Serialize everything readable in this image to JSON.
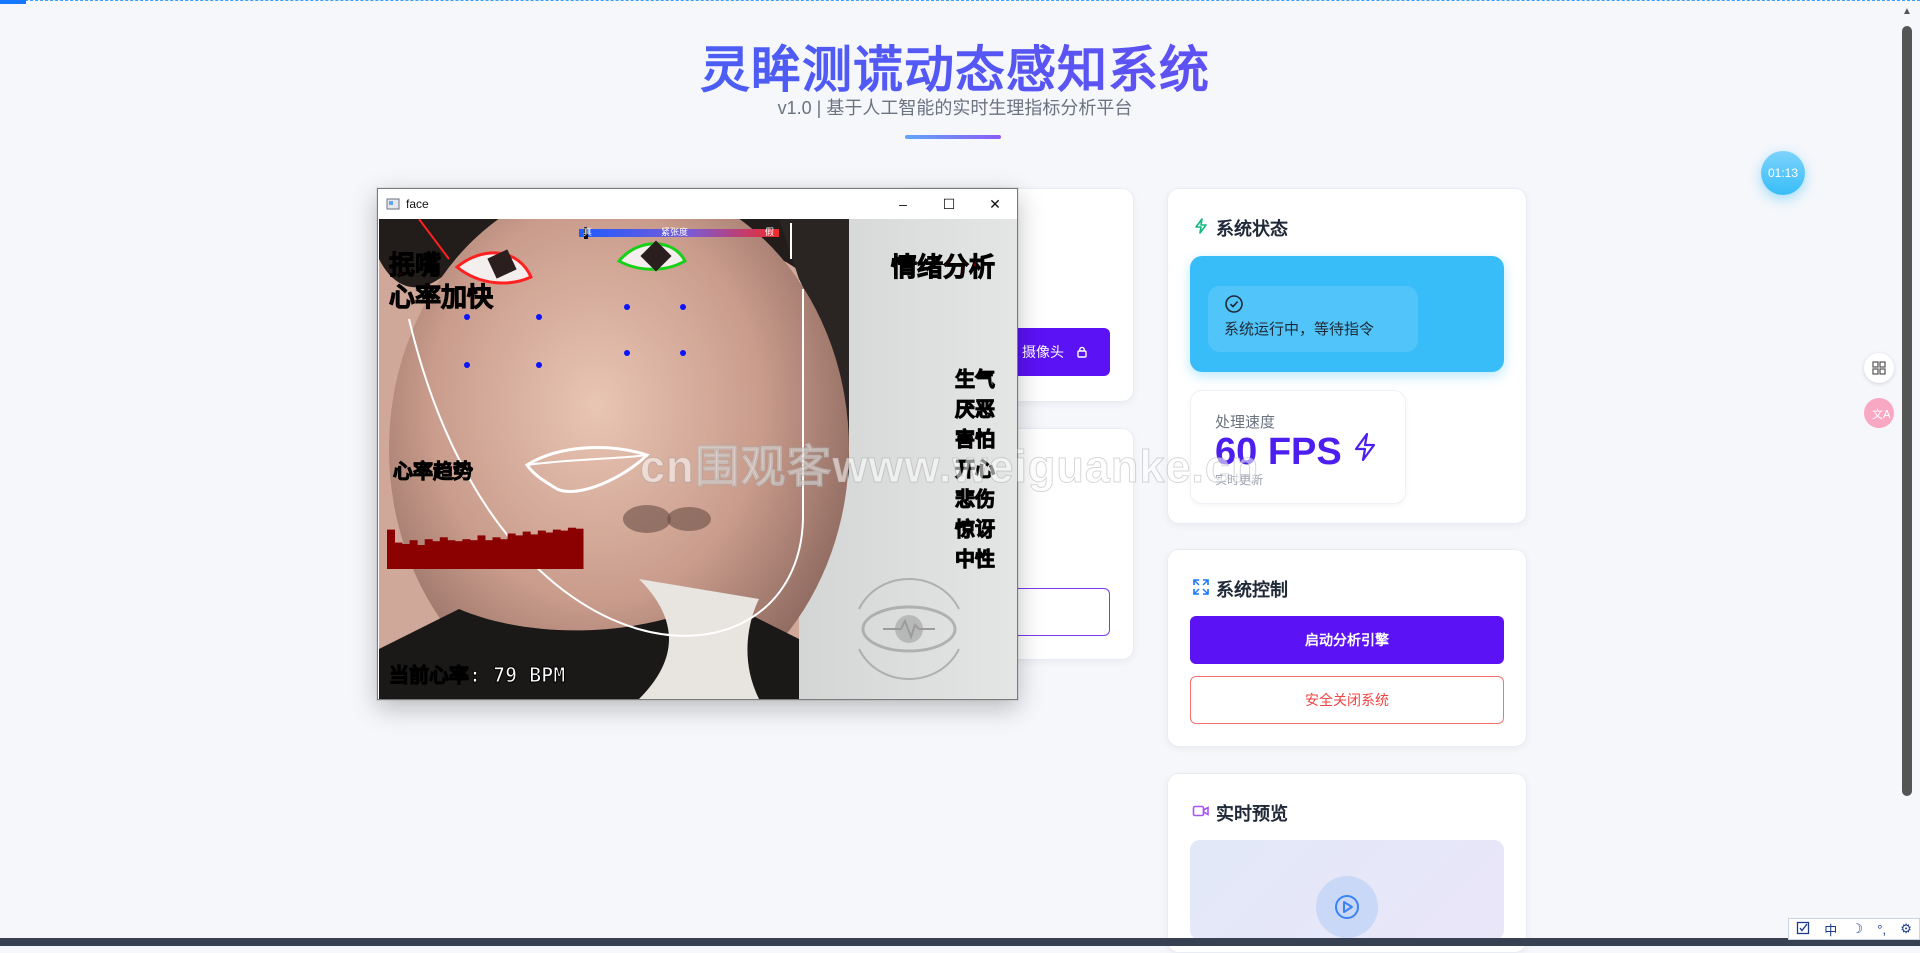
{
  "header": {
    "title": "灵眸测谎动态感知系统",
    "subtitle": "v1.0 | 基于人工智能的实时生理指标分析平台",
    "timer": "01:13"
  },
  "left_panel": {
    "camera_button_partial": "摄像头"
  },
  "system_status": {
    "title": "系统状态",
    "message": "系统运行中，等待指令",
    "speed_label": "处理速度",
    "speed_value": "60 FPS",
    "speed_note": "实时更新"
  },
  "system_control": {
    "title": "系统控制",
    "start_label": "启动分析引擎",
    "shutdown_label": "安全关闭系统"
  },
  "preview": {
    "title": "实时预览"
  },
  "face_window": {
    "title": "face",
    "minimize": "–",
    "maximize": "☐",
    "close": "✕",
    "left_labels": [
      "抿嘴",
      "心率加快"
    ],
    "emotion_title": "情绪分析",
    "emotions": [
      "生气",
      "厌恶",
      "害怕",
      "开心",
      "悲伤",
      "惊讶",
      "中性"
    ],
    "trend_label": "心率趋势",
    "heart_rate_text": "当前心率: 79 BPM",
    "bar_labels": [
      "真",
      "紧张度",
      "假"
    ]
  },
  "heart_rate_history": {
    "unit": "BPM",
    "values": [
      0.82,
      0.55,
      0.52,
      0.6,
      0.5,
      0.62,
      0.58,
      0.66,
      0.6,
      0.58,
      0.62,
      0.6,
      0.7,
      0.6,
      0.66,
      0.62,
      0.74,
      0.7,
      0.78,
      0.72,
      0.8,
      0.76,
      0.82,
      0.8,
      0.86,
      0.84
    ]
  },
  "watermark": "cn围观客www.weiguanke.cn",
  "tray": {
    "items": [
      "中",
      "☽",
      "⚙"
    ]
  },
  "colors": {
    "accent": "#5b12f5",
    "status_bg": "#38bdf8",
    "danger": "#ef4444",
    "heart_bar": "#8b0000",
    "label_red": "#e00000"
  }
}
